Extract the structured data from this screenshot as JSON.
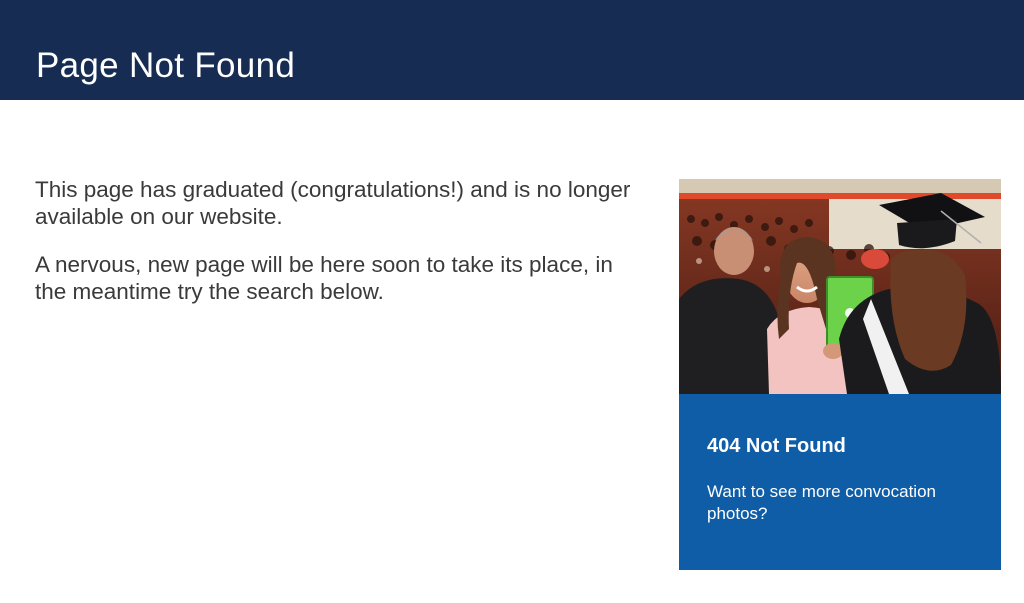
{
  "header": {
    "title": "Page Not Found"
  },
  "main": {
    "paragraphs": [
      "This page has graduated (congratulations!) and is no longer available on our website.",
      "A nervous, new page will be here soon to take its place, in the meantime try the search below."
    ]
  },
  "card": {
    "image_subject": "graduate-convocation-photo",
    "title": "404 Not Found",
    "link_text": "Want to see more convocation photos?"
  },
  "colors": {
    "header_bg": "#162c53",
    "card_bg": "#0e5da6",
    "body_text": "#3a3a3a"
  }
}
